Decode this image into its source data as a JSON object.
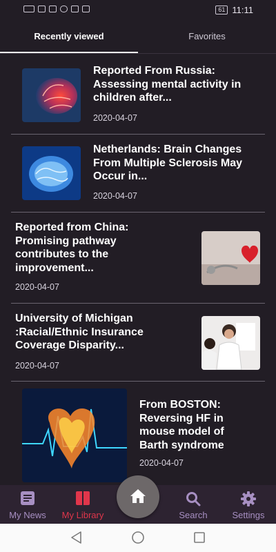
{
  "status_bar": {
    "clock": "11:11",
    "battery": "61"
  },
  "tabs": [
    {
      "label": "Recently viewed",
      "active": true
    },
    {
      "label": "Favorites",
      "active": false
    }
  ],
  "articles": [
    {
      "title_lines": [
        "Reported From Russia:",
        "Assessing mental activity in",
        "children after..."
      ],
      "date": "2020-04-07",
      "image": "brain-scan-red-image"
    },
    {
      "title_lines": [
        "Netherlands: Brain Changes",
        "From Multiple Sclerosis May",
        "Occur in..."
      ],
      "date": "2020-04-07",
      "image": "brain-blue-image"
    },
    {
      "title_lines": [
        "Reported from China:",
        "Promising pathway",
        "contributes to the",
        "improvement..."
      ],
      "date": "2020-04-07",
      "image": "heart-stethoscope-image"
    },
    {
      "title_lines": [
        "University of Michigan",
        ":Racial/Ethnic Insurance",
        "Coverage Disparity..."
      ],
      "date": "2020-04-07",
      "image": "doctor-patient-image"
    },
    {
      "title_lines": [
        "From BOSTON:",
        "Reversing HF in",
        "mouse model of",
        "Barth syndrome"
      ],
      "date": "2020-04-07",
      "image": "heart-ecg-image"
    }
  ],
  "bottom_nav": {
    "items": [
      {
        "label": "My News",
        "icon": "article-icon",
        "active": false
      },
      {
        "label": "My Library",
        "icon": "book-icon",
        "active": true
      },
      {
        "label": "Search",
        "icon": "search-icon",
        "active": false
      },
      {
        "label": "Settings",
        "icon": "gear-icon",
        "active": false
      }
    ],
    "home_icon": "home-icon"
  },
  "colors": {
    "background": "#221d25",
    "nav_background": "#2d2331",
    "active_nav": "#e0364b",
    "inactive_nav": "#a78fc2"
  }
}
